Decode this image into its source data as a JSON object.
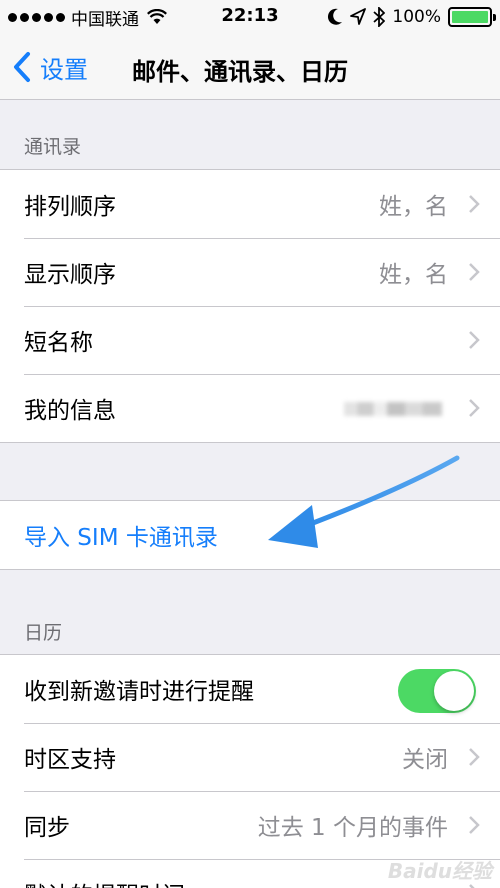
{
  "status_bar": {
    "carrier": "中国联通",
    "time": "22:13",
    "battery_percent": "100%",
    "battery_level": 1.0,
    "icons": [
      "signal-dots-icon",
      "wifi-icon",
      "moon-icon",
      "location-icon",
      "bluetooth-icon",
      "battery-icon"
    ]
  },
  "nav": {
    "back_label": "设置",
    "title": "邮件、通讯录、日历"
  },
  "contacts_section": {
    "header": "通讯录",
    "rows": [
      {
        "label": "排列顺序",
        "value": "姓，名"
      },
      {
        "label": "显示顺序",
        "value": "姓，名"
      },
      {
        "label": "短名称",
        "value": ""
      },
      {
        "label": "我的信息",
        "value": ""
      }
    ]
  },
  "import_section": {
    "label": "导入 SIM 卡通讯录"
  },
  "calendar_section": {
    "header": "日历",
    "rows": [
      {
        "label": "收到新邀请时进行提醒",
        "toggle_on": true
      },
      {
        "label": "时区支持",
        "value": "关闭"
      },
      {
        "label": "同步",
        "value": "过去 1 个月的事件"
      },
      {
        "label": "默认的提醒时间",
        "value": ""
      }
    ]
  },
  "colors": {
    "accent": "#157efb",
    "toggle_on": "#4cd964",
    "annotation_arrow": "#2f8be8",
    "background": "#efeff4"
  },
  "watermark": "Baidu经验"
}
